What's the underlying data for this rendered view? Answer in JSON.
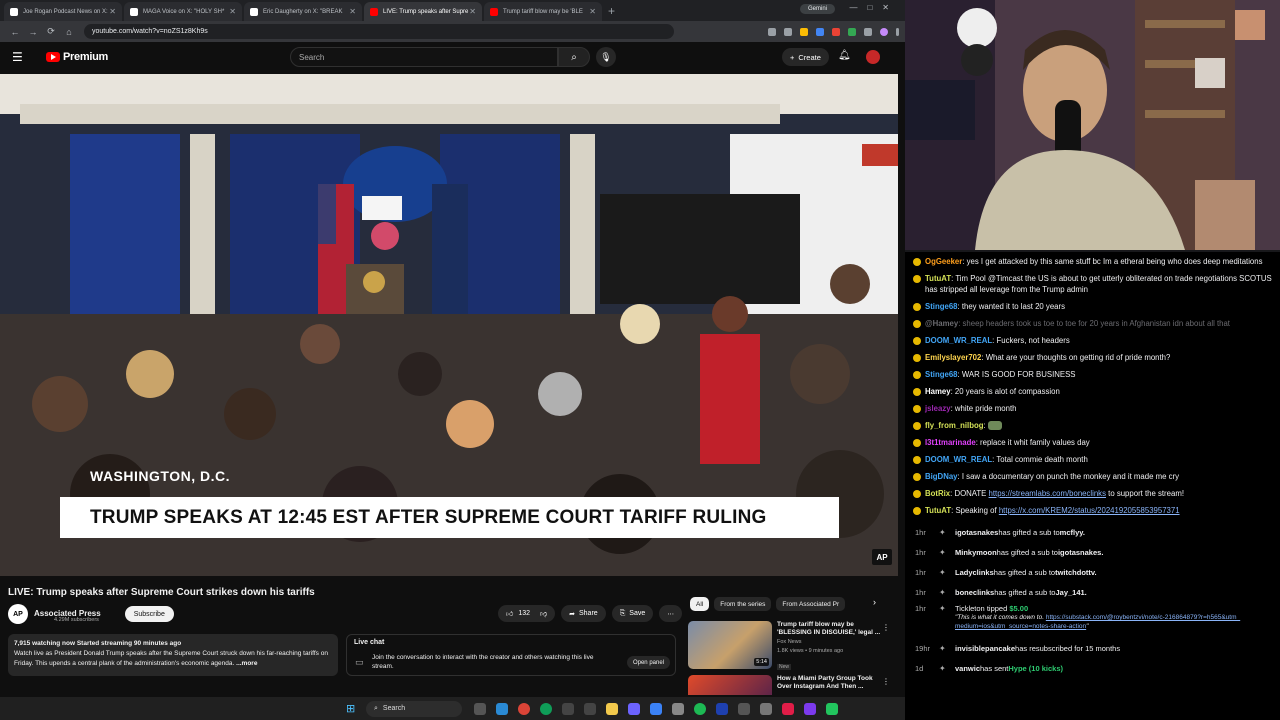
{
  "browser": {
    "tabs": [
      {
        "label": "Joe Rogan Podcast News on X:",
        "color": "#ffffff"
      },
      {
        "label": "MAGA Voice on X: \"HOLY SH*",
        "color": "#ffffff"
      },
      {
        "label": "Eric Daugherty on X: \"BREAK",
        "color": "#ffffff"
      },
      {
        "label": "LIVE: Trump speaks after Supre",
        "color": "#ff0000"
      },
      {
        "label": "Trump tariff blow may be 'BLE",
        "color": "#ff0000"
      }
    ],
    "gemini_label": "Gemini",
    "url": "youtube.com/watch?v=noZS1z8Kh9s"
  },
  "youtube": {
    "brand": "Premium",
    "search_placeholder": "Search",
    "create_label": "Create",
    "video": {
      "location": "WASHINGTON, D.C.",
      "headline": "TRUMP SPEAKS AT 12:45 EST AFTER SUPREME COURT TARIFF RULING",
      "bug": "AP"
    },
    "title": "LIVE: Trump speaks after Supreme Court strikes down his tariffs",
    "channel": {
      "logo": "AP",
      "name": "Associated Press",
      "subs": "4.29M subscribers",
      "subscribe_label": "Subscribe"
    },
    "actions": {
      "likes": "132",
      "share": "Share",
      "save": "Save",
      "more": "⋯"
    },
    "description": {
      "meta": "7,915 watching now  Started streaming 90 minutes ago",
      "text": "Watch live as President Donald Trump speaks after the Supreme Court struck down his far-reaching tariffs on Friday. This upends a central plank of the administration's economic agenda.",
      "more": "...more"
    },
    "live_chat": {
      "title": "Live chat",
      "body": "Join the conversation to interact with the creator and others watching this live stream.",
      "open_panel": "Open panel"
    },
    "chips": [
      "All",
      "From the series",
      "From Associated Pr"
    ],
    "recommendations": [
      {
        "title": "Trump tariff blow may be 'BLESSING IN DISGUISE,' legal ...",
        "channel": "Fox News",
        "meta": "1.8K views • 9 minutes ago",
        "badge": "New",
        "duration": "5:14"
      },
      {
        "title": "How a Miami Party Group Took Over Instagram And Then ...",
        "channel": "",
        "meta": "",
        "badge": "",
        "duration": ""
      }
    ]
  },
  "taskbar": {
    "search_label": "Search"
  },
  "chat": {
    "messages": [
      {
        "user": "OgGeeker",
        "color": "#ff9f1c",
        "text": " yes I get attacked by this same stuff bc Im a etheral being who does deep meditations"
      },
      {
        "user": "TutuAT",
        "color": "#d4e157",
        "text": " Tim Pool @Timcast the US is about to get utterly obliterated on trade negotiations SCOTUS has stripped all leverage from the Trump admin"
      },
      {
        "user": "Stinge68",
        "color": "#42a5f5",
        "text": " they wanted it to last 20 years"
      },
      {
        "user": "@Hamey",
        "color": "#6b6b70",
        "text": " sheep headers took us toe to toe for 20 years in Afghanistan idn about all that",
        "dim": true
      },
      {
        "user": "DOOM_WR_REAL",
        "color": "#42a5f5",
        "text": " Fuckers, not headers"
      },
      {
        "user": "Emilyslayer702",
        "color": "#ffd54f",
        "text": " What are your thoughts on getting rid of pride month?"
      },
      {
        "user": "Stinge68",
        "color": "#42a5f5",
        "text": " WAR IS GOOD FOR BUSINESS"
      },
      {
        "user": "Hamey",
        "color": "#ffffff",
        "text": " 20 years is alot of compassion"
      },
      {
        "user": "jsleazy",
        "color": "#9c27b0",
        "text": " white pride month"
      },
      {
        "user": "fly_from_nilbog",
        "color": "#d4e157",
        "text": " "
      },
      {
        "user": "l3t1tmarinade",
        "color": "#e040fb",
        "text": " replace it whit family values day"
      },
      {
        "user": "DOOM_WR_REAL",
        "color": "#42a5f5",
        "text": " Total commie death month"
      },
      {
        "user": "BigDNay",
        "color": "#42a5f5",
        "text": " I saw a documentary on punch the monkey and it made me cry"
      },
      {
        "user": "BotRix",
        "color": "#d4e157",
        "text": " DONATE ",
        "link": "https://streamlabs.com/boneclinks",
        "after": " to support the stream!"
      },
      {
        "user": "TutuAT",
        "color": "#d4e157",
        "text": " Speaking of ",
        "link": "https://x.com/KREM2/status/2024192055853957371",
        "after": ""
      }
    ],
    "events": [
      {
        "time": "1hr",
        "user": "igotasnakes",
        "text": " has gifted a sub to ",
        "target": "mcflyy."
      },
      {
        "time": "1hr",
        "user": "Minkymoon",
        "text": " has gifted a sub to ",
        "target": "igotasnakes."
      },
      {
        "time": "1hr",
        "user": "Ladyclinks",
        "text": " has gifted a sub to ",
        "target": "twitchdottv."
      },
      {
        "time": "1hr",
        "user": "boneclinks",
        "text": " has gifted a sub to ",
        "target": "Jay_141."
      }
    ],
    "tip": {
      "time": "1hr",
      "user": "Tickleton",
      "text": " tipped ",
      "amount": "$5.00",
      "quote": "\"This is what it comes down to. ",
      "link": "https://substack.com/@roybentzvi/note/c-216864879?r=h565&utm_medium=ios&utm_source=notes-share-action",
      "close": "\""
    },
    "events2": [
      {
        "time": "19hr",
        "user": "invisiblepancake",
        "text": " has resubscribed for 15 months",
        "target": ""
      },
      {
        "time": "1d",
        "user": "vanwic",
        "text": " has sent ",
        "target": "Hype (10 kicks)"
      }
    ]
  }
}
